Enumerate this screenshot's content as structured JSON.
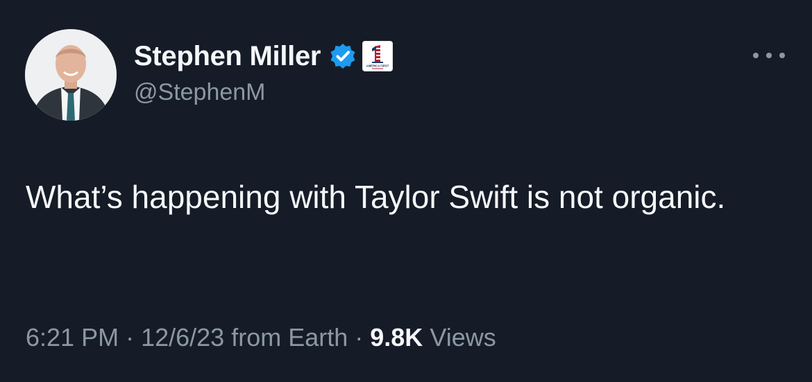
{
  "author": {
    "display_name": "Stephen Miller",
    "handle": "@StephenM",
    "verified_icon": "verified-badge-icon",
    "affiliation_badge": "america-first-legal-logo",
    "affiliation_text": "AMERICA FIRST"
  },
  "tweet": {
    "text": "What’s happening with Taylor Swift is not organic.",
    "time": "6:21 PM",
    "date": "12/6/23",
    "source": "from Earth",
    "separator": "·",
    "views_count": "9.8K",
    "views_label": "Views"
  },
  "colors": {
    "background": "#161c27",
    "primary_text": "#f5f7fa",
    "secondary_text": "#8b98a5",
    "verified_blue": "#1d9bf0"
  },
  "icons": {
    "more": "more-options-icon"
  }
}
